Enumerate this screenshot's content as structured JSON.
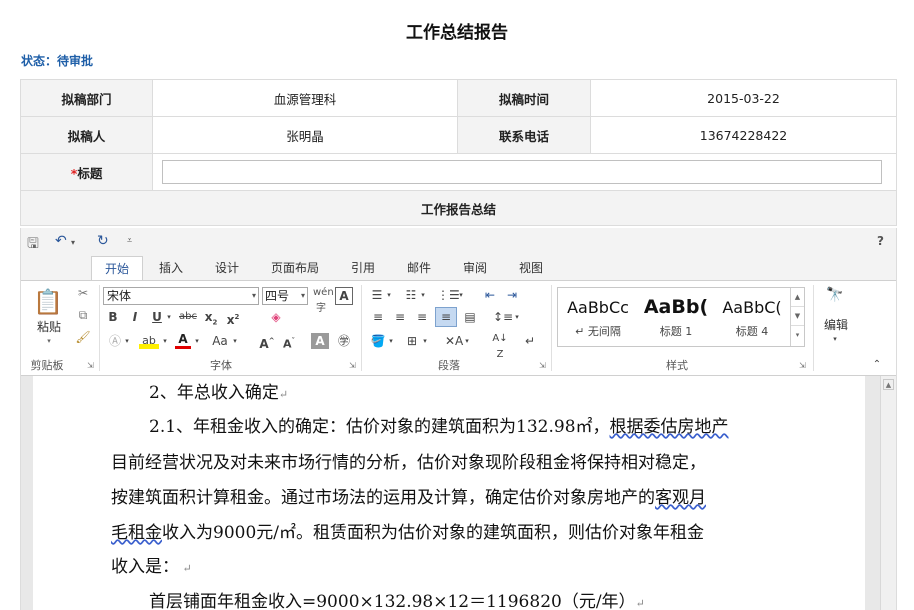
{
  "page": {
    "title": "工作总结报告",
    "status": "状态：待审批"
  },
  "form": {
    "dept_label": "拟稿部门",
    "dept_value": "血源管理科",
    "time_label": "拟稿时间",
    "time_value": "2015-03-22",
    "author_label": "拟稿人",
    "author_value": "张明晶",
    "phone_label": "联系电话",
    "phone_value": "13674228422",
    "title_required": "*",
    "title_label": "标题",
    "title_value": "",
    "section_label": "工作报告总结"
  },
  "editor": {
    "help": "?",
    "tabs": [
      {
        "label": "开始",
        "active": true
      },
      {
        "label": "插入"
      },
      {
        "label": "设计"
      },
      {
        "label": "页面布局"
      },
      {
        "label": "引用"
      },
      {
        "label": "邮件"
      },
      {
        "label": "审阅"
      },
      {
        "label": "视图"
      }
    ],
    "ribbon": {
      "paste_label": "粘贴",
      "clipboard_label": "剪贴板",
      "font_name": "宋体",
      "font_size": "四号",
      "font_group_label": "字体",
      "paragraph_label": "段落",
      "styles_label": "样式",
      "edit_label": "编辑",
      "styles": [
        {
          "preview": "AaBbCc",
          "name": "↵ 无间隔"
        },
        {
          "preview": "AaBb(",
          "name": "标题 1"
        },
        {
          "preview": "AaBbC(",
          "name": "标题 4"
        }
      ]
    },
    "document": {
      "lines": [
        "2、年总收入确定",
        "2.1、年租金收入的确定：估价对象的建筑面积为132.98㎡，",
        "根据委估房地产",
        "目前经营状况及对未来市场行情的分析，估价对象现阶段租金将保持相对稳定，",
        "按建筑面积计算租金。通过市场法的运用及计算，确定估价对象房地产的",
        "客观月",
        "毛租金",
        "收入为9000元/㎡。租赁面积为估价对象的建筑面积，则估价对象年租金",
        "收入是：",
        "首层铺面年租金收入=9000×132.98×12＝1196820（元/年）"
      ]
    }
  }
}
